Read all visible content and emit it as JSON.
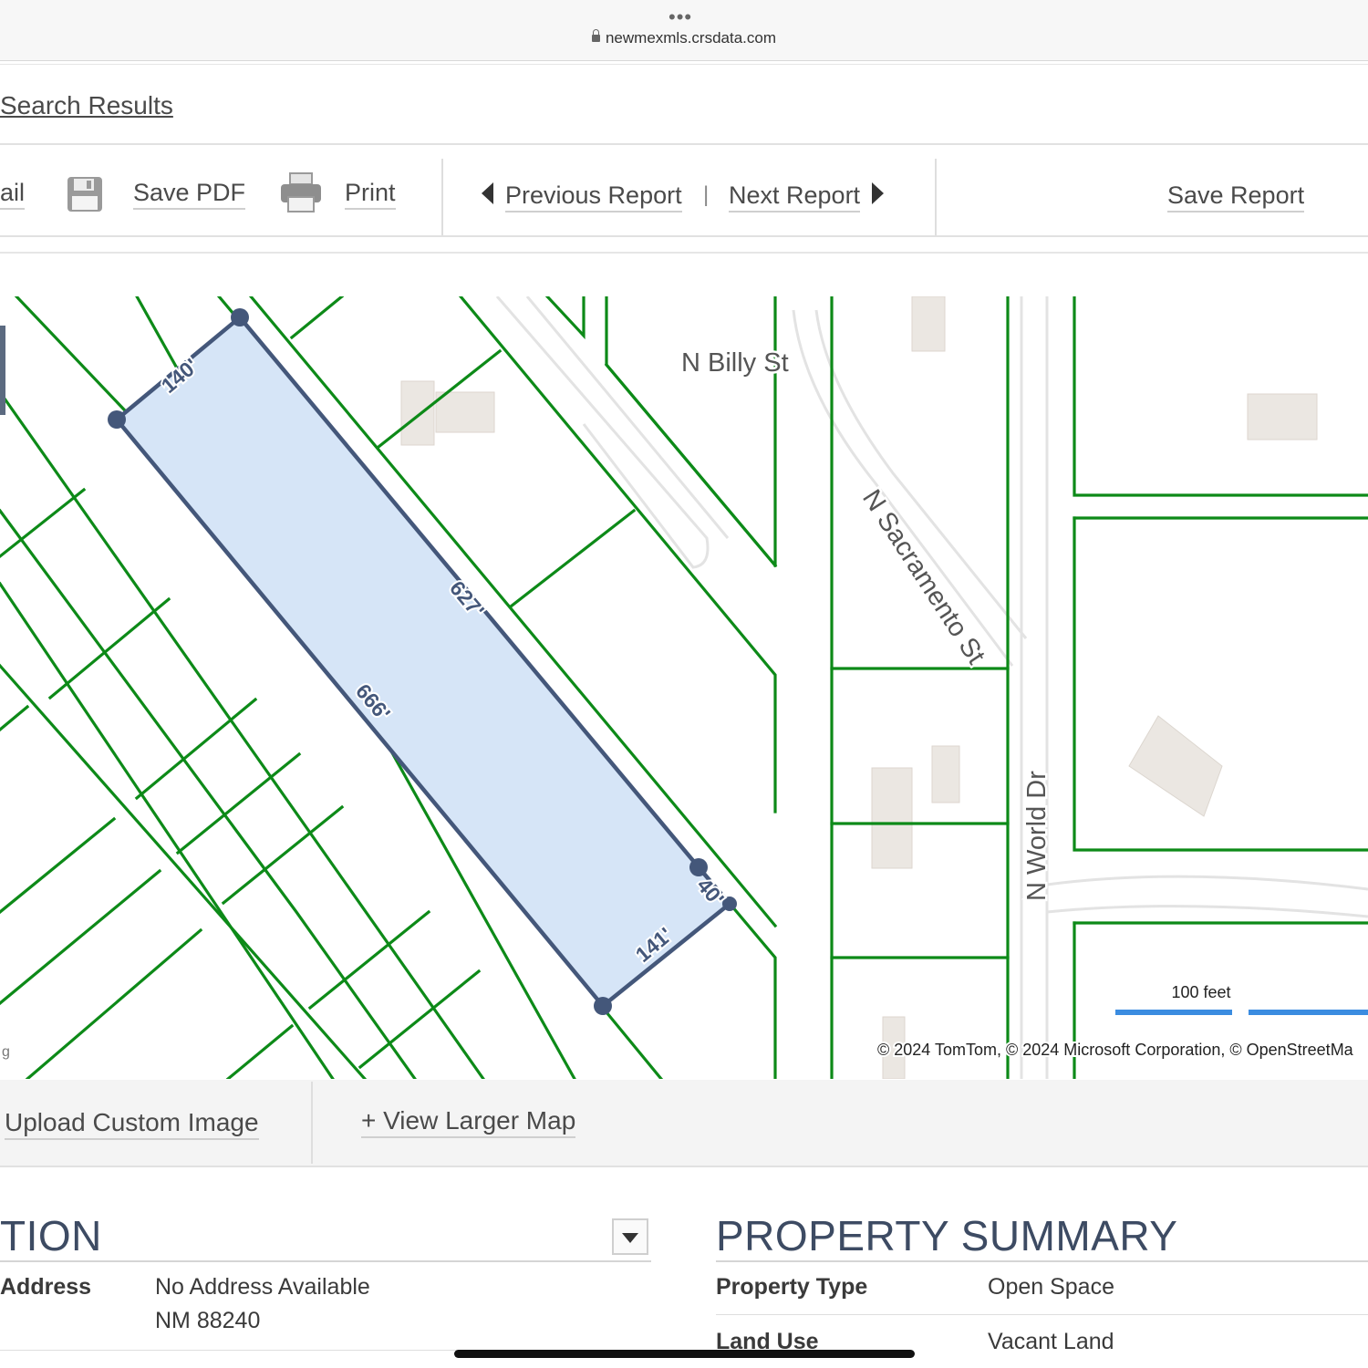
{
  "browser": {
    "url": "newmexmls.crsdata.com"
  },
  "breadcrumb": {
    "search_results": "Search Results"
  },
  "toolbar": {
    "email_partial": "ail",
    "save_pdf": "Save PDF",
    "print": "Print",
    "previous_report": "Previous Report",
    "separator": "|",
    "next_report": "Next Report",
    "save_report": "Save Report"
  },
  "map": {
    "streets": {
      "billy": "N Billy St",
      "sacramento": "N Sacramento St",
      "world": "N World Dr"
    },
    "dimensions": {
      "top": "140'",
      "right_long": "627'",
      "left_long": "666'",
      "bottom_short": "40'",
      "bottom": "141'"
    },
    "scale_label": "100 feet",
    "attribution": "© 2024 TomTom, © 2024 Microsoft Corporation, © OpenStreetMa",
    "left_edge_fragment": "g",
    "colors": {
      "parcel_line": "#0d8a18",
      "selected_fill": "#d6e5f7",
      "selected_stroke": "#44577a",
      "scale_bar": "#3b8ce0"
    }
  },
  "map_actions": {
    "upload_custom_image": "Upload Custom Image",
    "view_larger_map": "+ View Larger Map"
  },
  "location": {
    "title_partial": "TION",
    "address_label": "Address",
    "address_line1": "No Address Available",
    "address_line2": "NM 88240"
  },
  "property_summary": {
    "title": "PROPERTY SUMMARY",
    "property_type_label": "Property Type",
    "property_type_value": "Open Space",
    "land_use_label": "Land Use",
    "land_use_value": "Vacant Land"
  }
}
